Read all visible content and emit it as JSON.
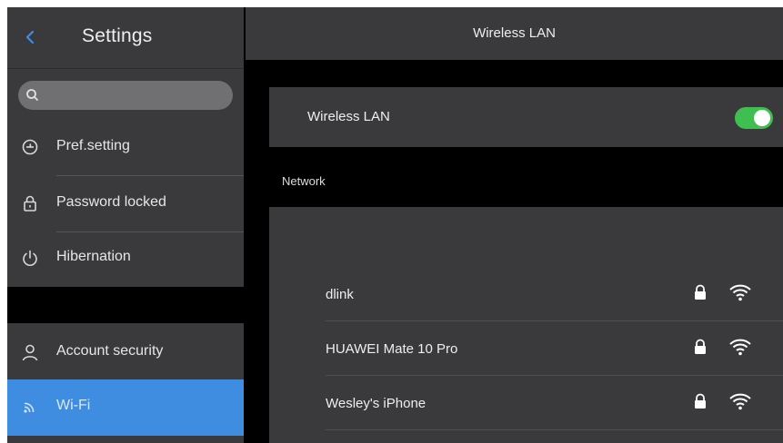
{
  "sidebar": {
    "title": "Settings",
    "search": {
      "placeholder": ""
    },
    "items": [
      {
        "label": "Pref.setting",
        "icon": "preference-icon"
      },
      {
        "label": "Password locked",
        "icon": "lock-icon"
      },
      {
        "label": "Hibernation",
        "icon": "power-icon"
      },
      {
        "label": "Account security",
        "icon": "person-icon"
      },
      {
        "label": "Wi-Fi",
        "icon": "wifi-icon",
        "active": true
      }
    ]
  },
  "main": {
    "title": "Wireless LAN",
    "wlan": {
      "label": "Wireless LAN",
      "enabled": true
    },
    "network_section_label": "Network",
    "networks": [
      {
        "name": "dlink",
        "secured": true
      },
      {
        "name": "HUAWEI Mate 10 Pro",
        "secured": true
      },
      {
        "name": "Wesley's iPhone",
        "secured": true
      }
    ]
  },
  "colors": {
    "accent": "#3e8de0",
    "toggle_on": "#3fbf4f",
    "panel": "#3a3a3c",
    "background": "#000000"
  }
}
